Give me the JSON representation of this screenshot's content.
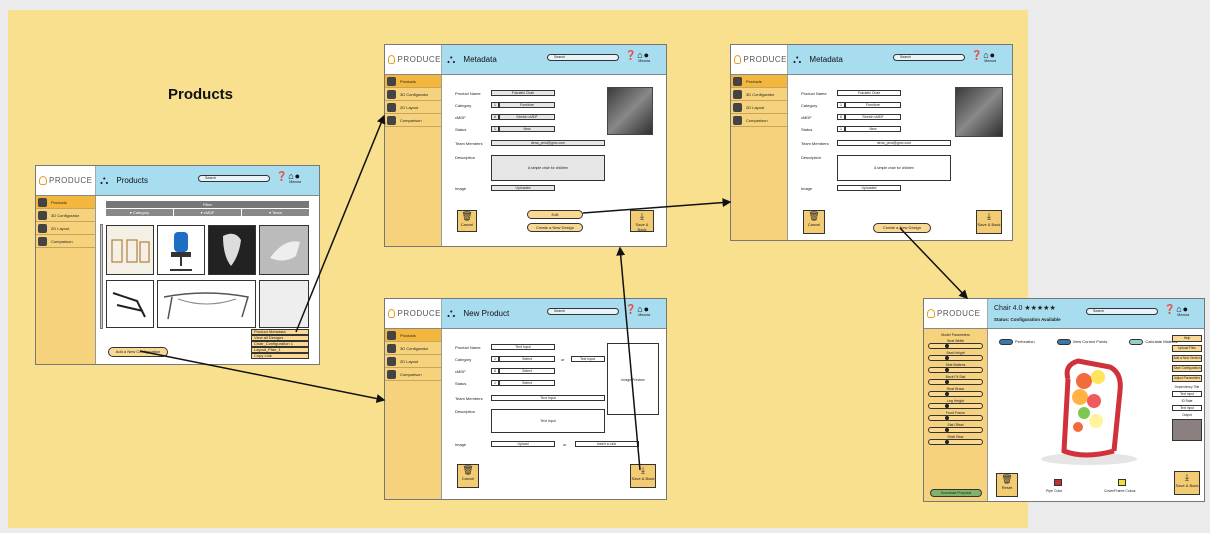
{
  "diagram_title": "Products",
  "common": {
    "logo_text": "PRODUCE",
    "search": "Search",
    "user": "Mezura",
    "sidebar": [
      "Products",
      "3D Configurator",
      "2D Layout",
      "Comparison"
    ]
  },
  "products_screen": {
    "title": "Products",
    "filter": "Filter",
    "filter_cols": [
      "▾ Category",
      "▾ cMDF",
      "▾ Team"
    ],
    "context_menu": [
      "Product Metadata",
      "View all Designs",
      "Chair_Configuration 1",
      "Layout_Plan_1",
      "Copy Link"
    ],
    "add_button": "Add a New Configuration"
  },
  "metadata_screen_1": {
    "title": "Metadata",
    "fields": [
      {
        "label": "Product Name",
        "value": "Fukuleki Chair"
      },
      {
        "label": "Category",
        "value": "Furniture",
        "prefix": "1"
      },
      {
        "label": "cMDF",
        "value": "Stretch cMDF",
        "prefix": "6"
      },
      {
        "label": "Status",
        "value": "New",
        "prefix": "1"
      },
      {
        "label": "Team Members",
        "value": "dena_pmd@gmx.com"
      },
      {
        "label": "Description",
        "value": "A simple chair for children"
      },
      {
        "label": "Image",
        "value": "Uploaded"
      }
    ],
    "edit": "Edit",
    "create": "Create a New Design",
    "cancel": "Cancel",
    "save": "Save & Back"
  },
  "metadata_screen_2": {
    "title": "Metadata",
    "fields": [
      {
        "label": "Product Name",
        "value": "Fukuleki Chair"
      },
      {
        "label": "Category",
        "value": "Furniture",
        "prefix": "1"
      },
      {
        "label": "cMDF",
        "value": "Stretch cMDF",
        "prefix": "6"
      },
      {
        "label": "Status",
        "value": "New",
        "prefix": "1"
      },
      {
        "label": "Team Members",
        "value": "dena_pmd@gmx.com"
      },
      {
        "label": "Description",
        "value": "A simple chair for children"
      },
      {
        "label": "Image",
        "value": "Uploaded"
      }
    ],
    "create": "Create a New Design",
    "cancel": "Cancel",
    "save": "Save & Back"
  },
  "new_product_screen": {
    "title": "New Product",
    "fields": [
      {
        "label": "Product Name",
        "value": "Text Input"
      },
      {
        "label": "Category",
        "value": "Select",
        "prefix": "1",
        "or": "or",
        "alt": "Text Input"
      },
      {
        "label": "cMDF",
        "value": "Select",
        "prefix": "6"
      },
      {
        "label": "Status",
        "value": "Select",
        "prefix": "1"
      },
      {
        "label": "Team Members",
        "value": "Text Input"
      },
      {
        "label": "Description",
        "value": "Text Input"
      },
      {
        "label": "Image",
        "value": "Upload",
        "or": "or",
        "alt": "Insert a Link"
      }
    ],
    "preview": "Image Preview",
    "cancel": "Cancel",
    "save": "Save & Back"
  },
  "configurator_screen": {
    "title": "Chair 4.0",
    "stars": "★★★★★",
    "status": "Status: Configuration Available",
    "params_title": "Model Parameters",
    "params": [
      "Seat Width",
      "Seat Height",
      "Side Battens",
      "Back Fit Slat",
      "Rear Brace",
      "Leg Height",
      "Front Frame",
      "Slat Offset",
      "Shell Rear"
    ],
    "toggles": [
      "Perforation",
      "View Control Points",
      "Calculate Material"
    ],
    "right_buttons": [
      "Help",
      "Upload Files",
      "Add a New Version",
      "Save Configuration",
      "Adjust Parameters"
    ],
    "right_labels": [
      "Dependency Title",
      "Text Input",
      "ID Rate",
      "Text Input",
      "Output"
    ],
    "color_labels": [
      "Pipe Color",
      "Cover/Frame Colour"
    ],
    "reset": "Reset",
    "save": "Save & Back",
    "download_button": "Download Proposal",
    "pipe_color": "#c0303a",
    "cover_color": "#eedd44"
  },
  "colors": {
    "canvas": "#f8e08e",
    "header": "#a8dcef",
    "sidebar": "#f7d27c"
  }
}
